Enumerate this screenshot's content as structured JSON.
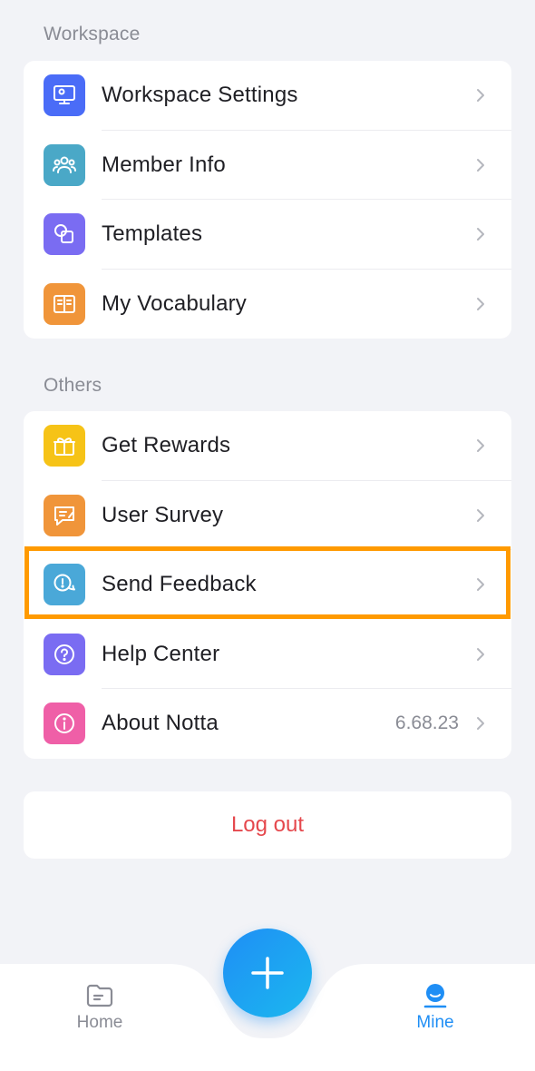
{
  "workspace": {
    "title": "Workspace",
    "items": [
      {
        "label": "Workspace Settings",
        "icon": "monitor-gear-icon",
        "color": "#4a6cf7"
      },
      {
        "label": "Member Info",
        "icon": "members-icon",
        "color": "#4aa8c7"
      },
      {
        "label": "Templates",
        "icon": "templates-icon",
        "color": "#7a6cf2"
      },
      {
        "label": "My Vocabulary",
        "icon": "book-icon",
        "color": "#f0953a"
      }
    ]
  },
  "others": {
    "title": "Others",
    "items": [
      {
        "label": "Get Rewards",
        "icon": "gift-icon",
        "color": "#f6c317"
      },
      {
        "label": "User Survey",
        "icon": "survey-icon",
        "color": "#f0953a"
      },
      {
        "label": "Send Feedback",
        "icon": "feedback-icon",
        "color": "#4aa8d8"
      },
      {
        "label": "Help Center",
        "icon": "help-icon",
        "color": "#7a6cf2"
      },
      {
        "label": "About Notta",
        "icon": "info-icon",
        "color": "#ef5fa7",
        "value": "6.68.23"
      }
    ]
  },
  "logout_label": "Log out",
  "tabs": {
    "home": "Home",
    "mine": "Mine"
  },
  "colors": {
    "accent": "#1f8ef5",
    "highlight": "#ff9a00",
    "logout": "#e5484d"
  }
}
